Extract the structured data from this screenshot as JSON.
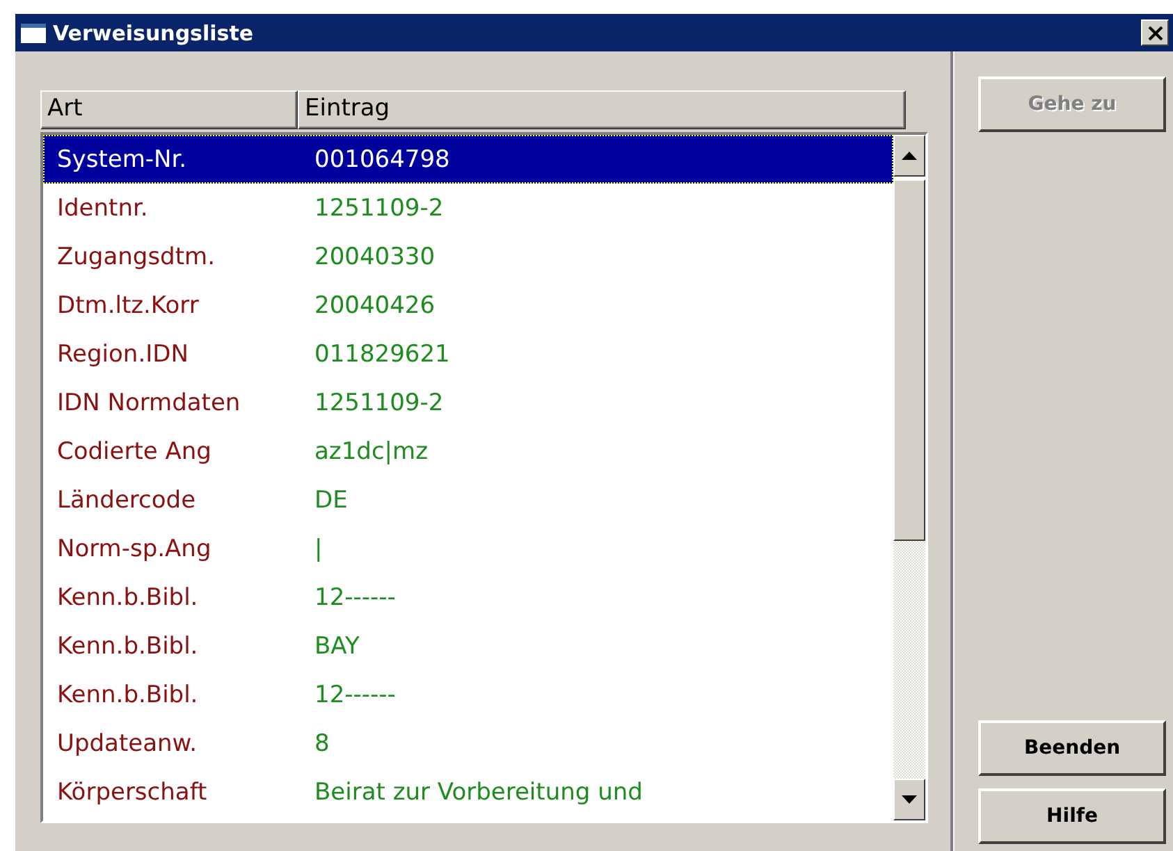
{
  "window": {
    "title": "Verweisungsliste"
  },
  "table": {
    "columns": [
      "Art",
      "Eintrag"
    ],
    "rows": [
      {
        "art": "System-Nr.",
        "eintrag": "001064798",
        "selected": true
      },
      {
        "art": "Identnr.",
        "eintrag": "1251109-2",
        "selected": false
      },
      {
        "art": "Zugangsdtm.",
        "eintrag": "20040330",
        "selected": false
      },
      {
        "art": "Dtm.ltz.Korr",
        "eintrag": "20040426",
        "selected": false
      },
      {
        "art": "Region.IDN",
        "eintrag": "011829621",
        "selected": false
      },
      {
        "art": "IDN Normdaten",
        "eintrag": "1251109-2",
        "selected": false
      },
      {
        "art": "Codierte Ang",
        "eintrag": "az1dc|mz",
        "selected": false
      },
      {
        "art": "Ländercode",
        "eintrag": "DE",
        "selected": false
      },
      {
        "art": "Norm-sp.Ang",
        "eintrag": "|",
        "selected": false
      },
      {
        "art": "Kenn.b.Bibl.",
        "eintrag": "12------",
        "selected": false
      },
      {
        "art": "Kenn.b.Bibl.",
        "eintrag": "BAY",
        "selected": false
      },
      {
        "art": "Kenn.b.Bibl.",
        "eintrag": "12------",
        "selected": false
      },
      {
        "art": "Updateanw.",
        "eintrag": "8",
        "selected": false
      },
      {
        "art": "Körperschaft",
        "eintrag": "Beirat zur Vorbereitung und",
        "selected": false
      }
    ]
  },
  "top_buttons": [
    {
      "label": "Gehe zu",
      "disabled": true
    }
  ],
  "bottom_buttons": [
    {
      "label": "Beenden",
      "disabled": false
    },
    {
      "label": "Hilfe",
      "disabled": false
    }
  ]
}
